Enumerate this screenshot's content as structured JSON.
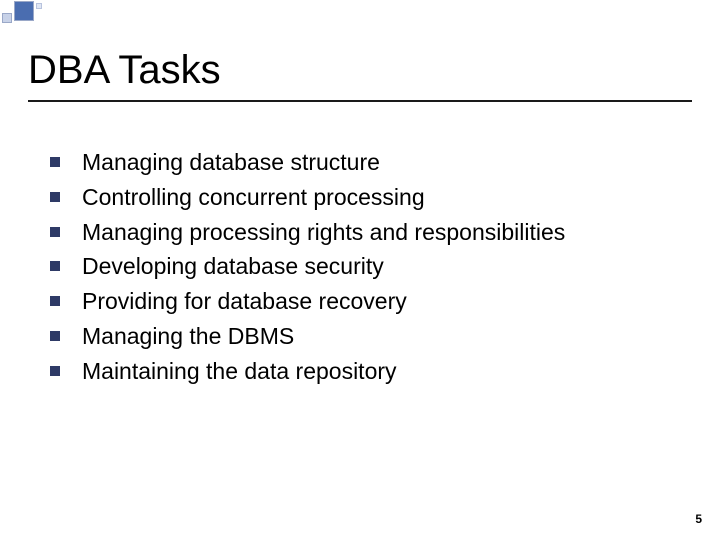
{
  "slide": {
    "title": "DBA Tasks",
    "bullets": [
      "Managing database structure",
      "Controlling concurrent processing",
      "Managing processing rights and responsibilities",
      "Developing database security",
      "Providing for database recovery",
      "Managing the DBMS",
      "Maintaining the data repository"
    ],
    "page_number": "5"
  }
}
